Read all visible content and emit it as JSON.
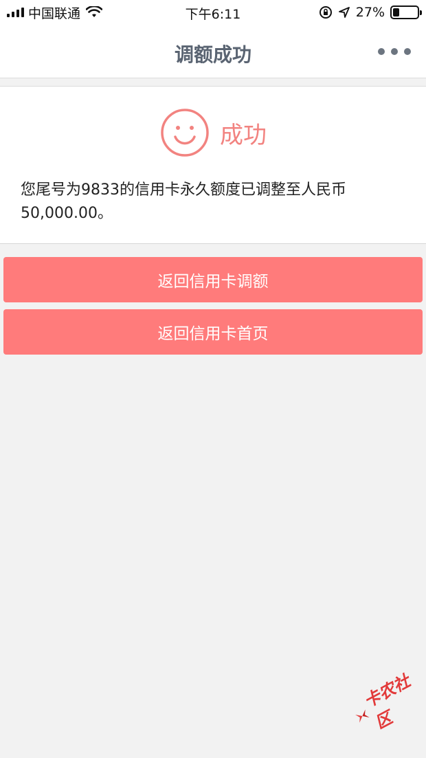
{
  "status_bar": {
    "carrier": "中国联通",
    "time": "下午6:11",
    "battery_percent": "27%",
    "battery_level": 0.27
  },
  "nav": {
    "title": "调额成功"
  },
  "result": {
    "title": "成功",
    "message": "您尾号为9833的信用卡永久额度已调整至人民币 50,000.00。"
  },
  "buttons": {
    "back_adjust": "返回信用卡调额",
    "back_home": "返回信用卡首页"
  },
  "watermark": {
    "text": "卡农社区"
  },
  "colors": {
    "accent": "#ff7b7b",
    "success_text": "#f28380",
    "nav_title": "#5a6472"
  }
}
